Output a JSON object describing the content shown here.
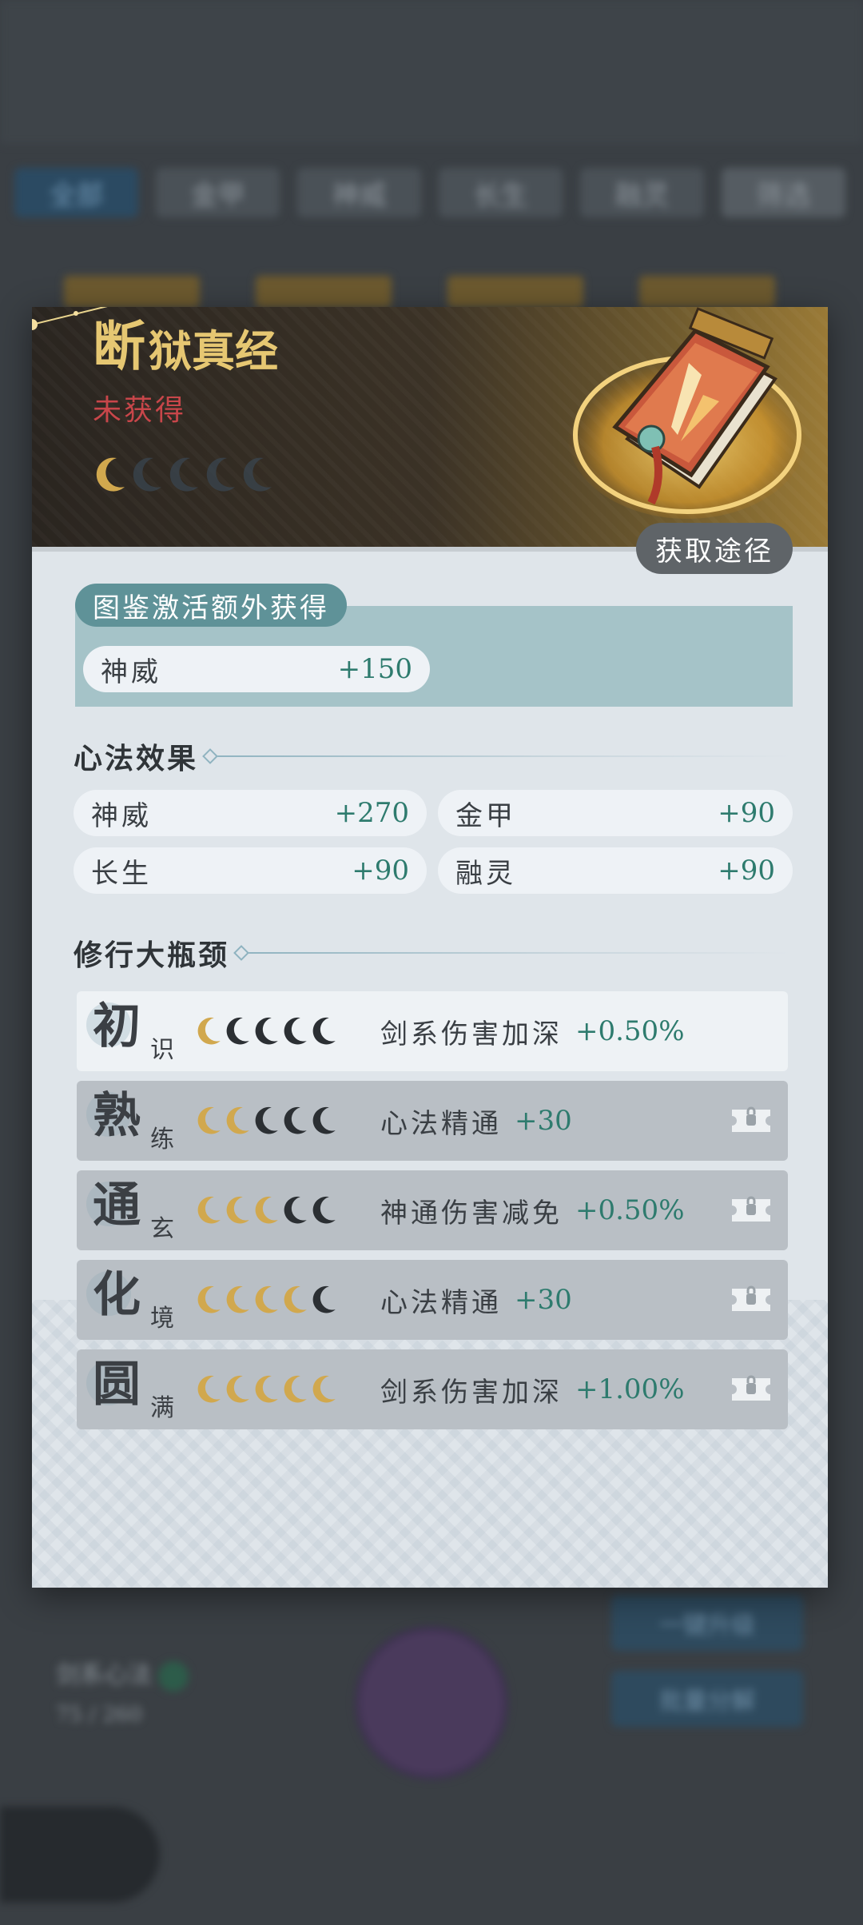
{
  "background": {
    "tabs": [
      "全部",
      "金甲",
      "神威",
      "长生",
      "融灵",
      "筛选"
    ],
    "bottom_left": {
      "title": "剑系心法",
      "sub": "75 / 260"
    },
    "buttons": [
      "一键升级",
      "批量分解"
    ]
  },
  "header": {
    "title_first": "断",
    "title_rest": "狱真经",
    "status": "未获得",
    "rank_total": 5,
    "rank_filled": 1,
    "acquire_button": "获取途径"
  },
  "collection": {
    "tag": "图鉴激活额外获得",
    "stat": {
      "name": "神威",
      "value": "+150"
    }
  },
  "effects": {
    "title": "心法效果",
    "items": [
      {
        "name": "神威",
        "value": "+270"
      },
      {
        "name": "金甲",
        "value": "+90"
      },
      {
        "name": "长生",
        "value": "+90"
      },
      {
        "name": "融灵",
        "value": "+90"
      }
    ]
  },
  "bottleneck": {
    "title": "修行大瓶颈",
    "rows": [
      {
        "stage_big": "初",
        "stage_small": "识",
        "filled": 1,
        "effect": "剑系伤害加深",
        "value": "+0.50%",
        "locked": false
      },
      {
        "stage_big": "熟",
        "stage_small": "练",
        "filled": 2,
        "effect": "心法精通",
        "value": "+30",
        "locked": true
      },
      {
        "stage_big": "通",
        "stage_small": "玄",
        "filled": 3,
        "effect": "神通伤害减免",
        "value": "+0.50%",
        "locked": true
      },
      {
        "stage_big": "化",
        "stage_small": "境",
        "filled": 4,
        "effect": "心法精通",
        "value": "+30",
        "locked": true
      },
      {
        "stage_big": "圆",
        "stage_small": "满",
        "filled": 5,
        "effect": "剑系伤害加深",
        "value": "+1.00%",
        "locked": true
      }
    ]
  },
  "colors": {
    "gold": "#e6c772",
    "status_red": "#c8464a",
    "value_green": "#2e7b6e",
    "moon_gold": "#d1a84e",
    "moon_dark": "#2b2f33"
  }
}
